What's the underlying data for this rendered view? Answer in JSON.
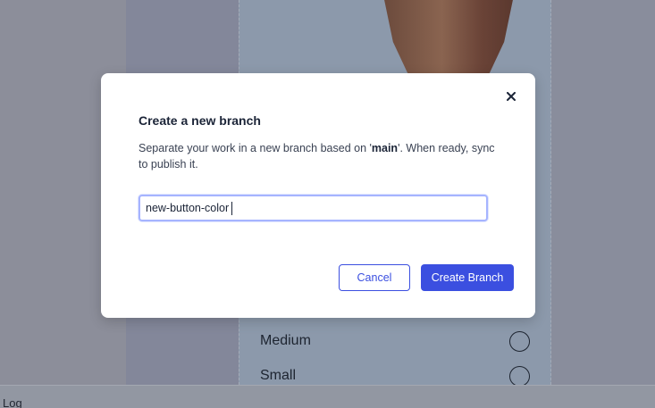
{
  "background": {
    "size_options": [
      {
        "label": "Medium"
      },
      {
        "label": "Small"
      }
    ],
    "bottom_bar_label": "Log"
  },
  "modal": {
    "title": "Create a new branch",
    "description_prefix": "Separate your work in a new branch based on '",
    "description_branch": "main",
    "description_suffix": "'. When ready, sync to publish it.",
    "input_value": "new-button-color",
    "cancel_label": "Cancel",
    "create_label": "Create Branch",
    "close_icon": "close-icon"
  },
  "colors": {
    "accent": "#3b4fe0",
    "input_focus_border": "#a6b4ff"
  }
}
